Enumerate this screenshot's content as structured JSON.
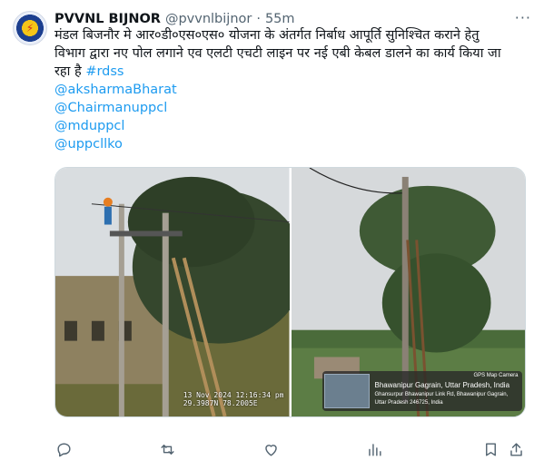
{
  "tweet": {
    "author_name": "PVVNL BIJNOR",
    "handle": "@pvvnlbijnor",
    "separator": "·",
    "time": "55m",
    "more_label": "···",
    "text_line1": "मंडल बिजनौर मे आर०डी०एस०एस० योजना  के अंतर्गत निर्बाध आपूर्ति सुनिश्चित कराने हेतु",
    "text_line2": "विभाग द्वारा नए पोल लगाने एव एलटी एचटी लाइन पर नई एबी केबल डालने का कार्य किया जा",
    "text_line3": "रहा है",
    "hashtag": "#rdss",
    "mentions": [
      "@aksharmaBharat",
      "@Chairmanuppcl",
      "@mduppcl",
      "@uppcllko"
    ]
  },
  "photo1": {
    "stamp_line1": "13 Nov 2024 12:16:34 pm",
    "stamp_line2": "29.3987N 78.2005E"
  },
  "photo2": {
    "gps_brand": "GPS Map Camera",
    "gps_line1": "Bhawanipur Gagrain, Uttar Pradesh, India",
    "gps_line2": "Ghansurpur Bhawanipur Link Rd, Bhawanipur Gagrain,",
    "gps_line3": "Uttar Pradesh 246725, India"
  },
  "colors": {
    "accent": "#1d9bf0",
    "muted": "#536471",
    "text": "#0f1419"
  }
}
